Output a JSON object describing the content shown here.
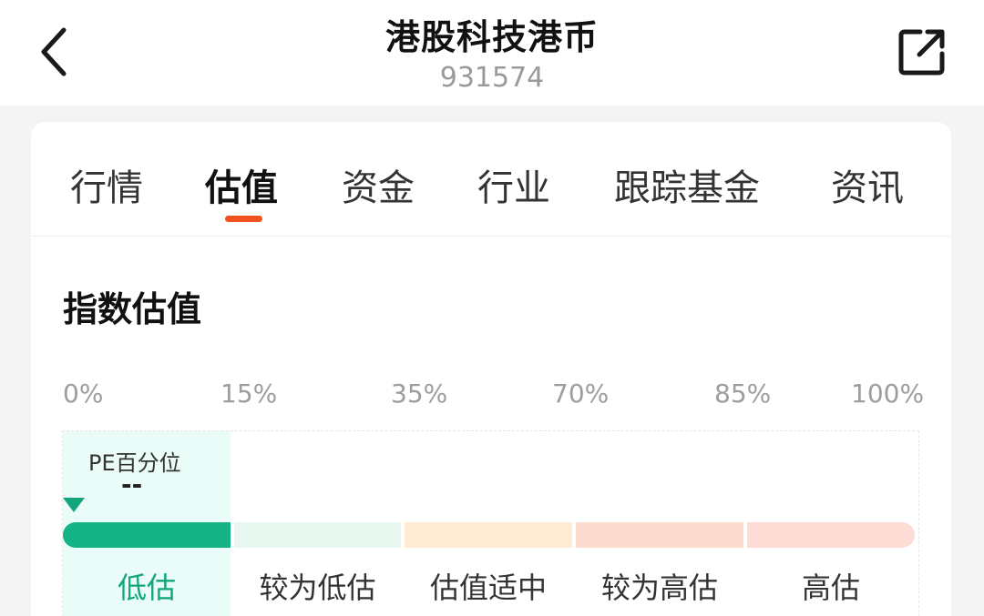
{
  "header": {
    "title": "港股科技港币",
    "code": "931574"
  },
  "tabs": [
    {
      "label": "行情",
      "active": false
    },
    {
      "label": "估值",
      "active": true
    },
    {
      "label": "资金",
      "active": false
    },
    {
      "label": "行业",
      "active": false
    },
    {
      "label": "跟踪基金",
      "active": false
    },
    {
      "label": "资讯",
      "active": false
    }
  ],
  "valuation": {
    "section_title": "指数估值",
    "ticks": [
      "0%",
      "15%",
      "35%",
      "70%",
      "85%",
      "100%"
    ],
    "pe_label": "PE百分位",
    "pe_value": "--",
    "segments": [
      {
        "label": "低估",
        "color": "#13b386",
        "active": true
      },
      {
        "label": "较为低估",
        "color": "#e9f7f1",
        "active": false
      },
      {
        "label": "估值适中",
        "color": "#fdebd3",
        "active": false
      },
      {
        "label": "较为高估",
        "color": "#fcdccf",
        "active": false
      },
      {
        "label": "高估",
        "color": "#fddcd6",
        "active": false
      }
    ]
  },
  "icons": {
    "back": "chevron-left-icon",
    "share": "share-icon"
  },
  "colors": {
    "accent": "#f0521e",
    "undervalued": "#13a57c"
  }
}
